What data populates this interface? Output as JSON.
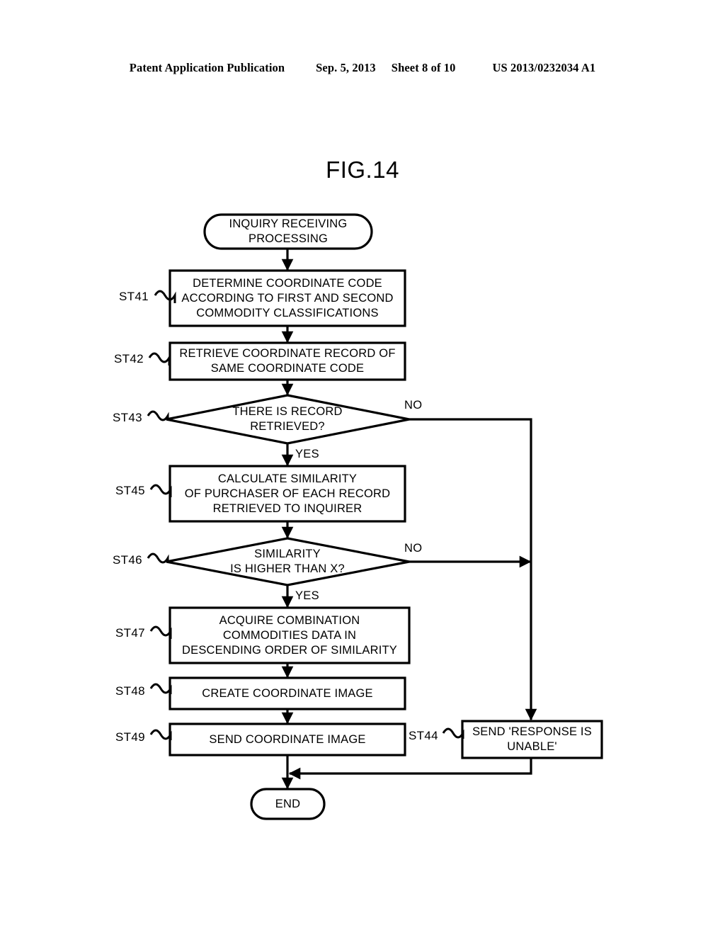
{
  "header": {
    "publication": "Patent Application Publication",
    "date": "Sep. 5, 2013",
    "sheet": "Sheet 8 of 10",
    "number": "US 2013/0232034 A1"
  },
  "figure": {
    "title": "FIG.14"
  },
  "flowchart": {
    "start": {
      "label": "start-terminator",
      "lines": [
        "INQUIRY RECEIVING",
        "PROCESSING"
      ]
    },
    "end": {
      "label": "end-terminator",
      "lines": [
        "END"
      ]
    },
    "steps": [
      {
        "id": "ST41",
        "lines": [
          "DETERMINE COORDINATE CODE",
          "ACCORDING TO FIRST AND SECOND",
          "COMMODITY CLASSIFICATIONS"
        ]
      },
      {
        "id": "ST42",
        "lines": [
          "RETRIEVE COORDINATE RECORD OF",
          "SAME COORDINATE CODE"
        ]
      },
      {
        "id": "ST43",
        "lines": [
          "THERE IS RECORD",
          "RETRIEVED?"
        ]
      },
      {
        "id": "ST45",
        "lines": [
          "CALCULATE SIMILARITY",
          "OF PURCHASER OF EACH RECORD",
          "RETRIEVED TO INQUIRER"
        ]
      },
      {
        "id": "ST46",
        "lines": [
          "SIMILARITY",
          "IS HIGHER THAN X?"
        ]
      },
      {
        "id": "ST47",
        "lines": [
          "ACQUIRE COMBINATION",
          "COMMODITIES DATA IN",
          "DESCENDING ORDER OF SIMILARITY"
        ]
      },
      {
        "id": "ST48",
        "lines": [
          "CREATE COORDINATE IMAGE"
        ]
      },
      {
        "id": "ST49",
        "lines": [
          "SEND COORDINATE IMAGE"
        ]
      },
      {
        "id": "ST44",
        "lines": [
          "SEND 'RESPONSE IS",
          "UNABLE'"
        ]
      }
    ],
    "edge_labels": {
      "st43_no": "NO",
      "st43_yes": "YES",
      "st46_no": "NO",
      "st46_yes": "YES"
    }
  },
  "colors": {
    "ink": "#000000",
    "paper": "#ffffff"
  }
}
